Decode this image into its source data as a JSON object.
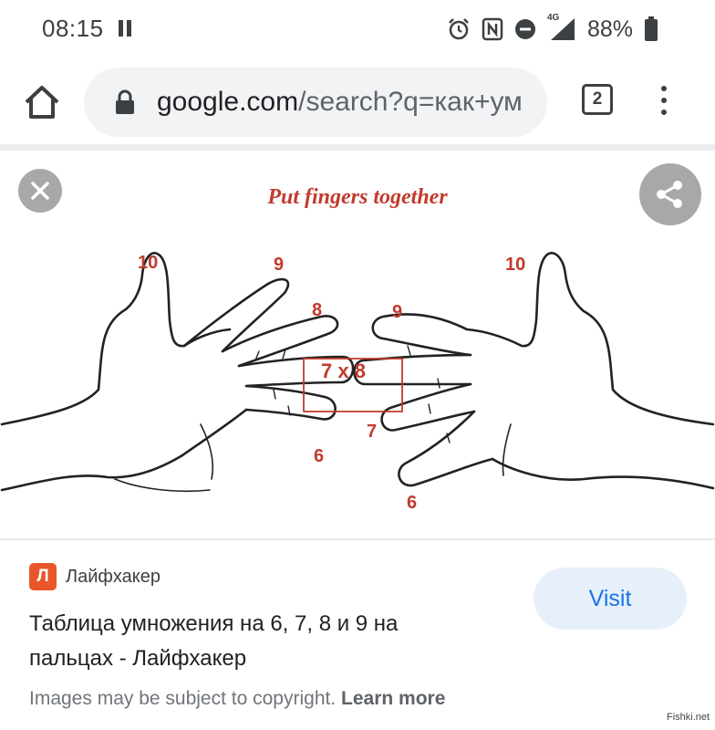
{
  "status_bar": {
    "time": "08:15",
    "signal_badge": "4G",
    "battery": "88%"
  },
  "toolbar": {
    "url_domain": "google.com",
    "url_path": "/search?q=как+ум",
    "tab_count": "2"
  },
  "viewer": {
    "caption": "Put fingers together",
    "finger_labels": {
      "left_thumb": "10",
      "left_index": "9",
      "left_middle": "8",
      "left_ring": "6",
      "right_thumb": "10",
      "right_index": "9",
      "right_ring": "7",
      "right_little": "6"
    },
    "multiplication": "7 x 8"
  },
  "result": {
    "favicon_letter": "Л",
    "source": "Лайфхакер",
    "title": "Таблица умножения на 6, 7, 8 и 9 на пальцах - Лайфхакер",
    "visit_label": "Visit",
    "copyright_text": "Images may be subject to copyright.",
    "learn_more": "Learn more"
  },
  "watermark": "Fishki.net",
  "colors": {
    "accent_red": "#c13a2d",
    "visit_blue": "#1a73e8",
    "favicon_orange": "#e8562a"
  }
}
